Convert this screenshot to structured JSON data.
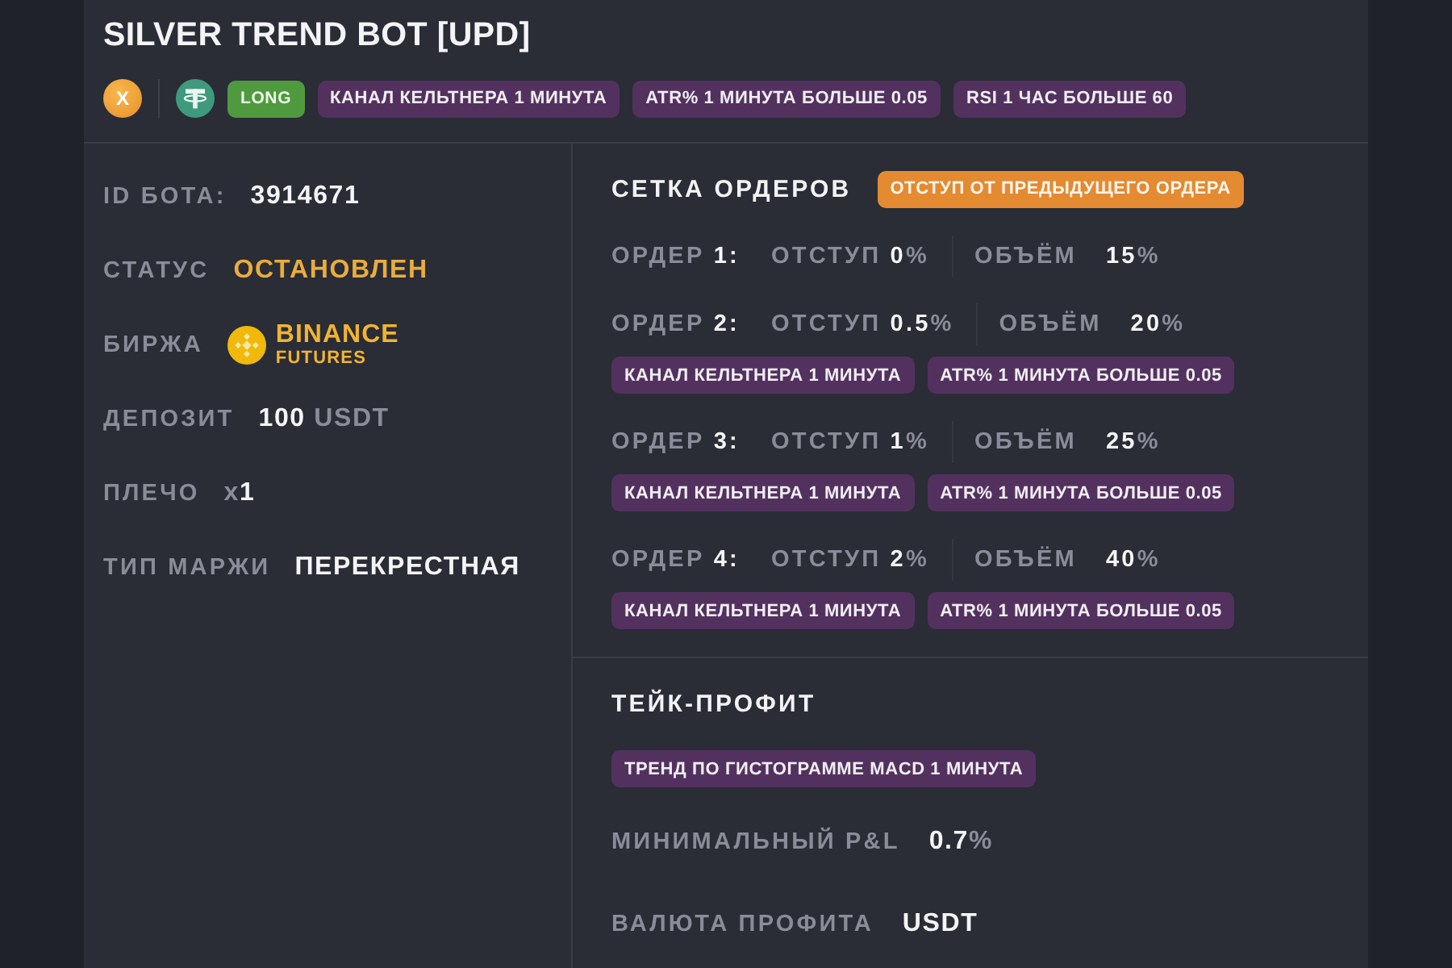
{
  "header": {
    "title": "SILVER TREND BOT [UPD]",
    "coin_symbol": "X",
    "tags": [
      {
        "kind": "side",
        "label": "LONG"
      },
      {
        "kind": "condition",
        "label": "КАНАЛ КЕЛЬТНЕРА 1 МИНУТА"
      },
      {
        "kind": "condition",
        "label": "ATR% 1 МИНУТА БОЛЬШЕ 0.05"
      },
      {
        "kind": "condition",
        "label": "RSI 1 ЧАС БОЛЬШЕ 60"
      }
    ]
  },
  "bot_info": [
    {
      "kind": "plain",
      "label": "ID БОТА:",
      "value": "3914671"
    },
    {
      "kind": "status",
      "label": "СТАТУС",
      "value": "ОСТАНОВЛЕН"
    },
    {
      "kind": "exchange",
      "label": "БИРЖА",
      "name": "BINANCE",
      "subtitle": "FUTURES"
    },
    {
      "kind": "amount",
      "label": "ДЕПОЗИТ",
      "value": "**100** USDT"
    },
    {
      "kind": "amount",
      "label": "ПЛЕЧО",
      "value": "x**1**"
    },
    {
      "kind": "plain",
      "label": "ТИП МАРЖИ",
      "value": "ПЕРЕКРЕСТНАЯ"
    }
  ],
  "order_grid": {
    "title": "СЕТКА ОРДЕРОВ",
    "mode_tag": {
      "kind": "mode",
      "label": "ОТСТУП ОТ ПРЕДЫДУЩЕГО ОРДЕРА"
    },
    "orders": [
      {
        "label": "ОРДЕР **1:**",
        "offset": "ОТСТУП **0**%",
        "volume_label": "ОБЪЁМ",
        "volume": "**15**%"
      },
      {
        "label": "ОРДЕР **2:**",
        "offset": "ОТСТУП **0.5**%",
        "volume_label": "ОБЪЁМ",
        "volume": "**20**%",
        "tags": [
          {
            "kind": "condition",
            "label": "КАНАЛ КЕЛЬТНЕРА 1 МИНУТА"
          },
          {
            "kind": "condition",
            "label": "ATR% 1 МИНУТА БОЛЬШЕ 0.05"
          }
        ]
      },
      {
        "label": "ОРДЕР **3:**",
        "offset": "ОТСТУП **1**%",
        "volume_label": "ОБЪЁМ",
        "volume": "**25**%",
        "tags": [
          {
            "kind": "condition",
            "label": "КАНАЛ КЕЛЬТНЕРА 1 МИНУТА"
          },
          {
            "kind": "condition",
            "label": "ATR% 1 МИНУТА БОЛЬШЕ 0.05"
          }
        ]
      },
      {
        "label": "ОРДЕР **4:**",
        "offset": "ОТСТУП **2**%",
        "volume_label": "ОБЪЁМ",
        "volume": "**40**%",
        "tags": [
          {
            "kind": "condition",
            "label": "КАНАЛ КЕЛЬТНЕРА 1 МИНУТА"
          },
          {
            "kind": "condition",
            "label": "ATR% 1 МИНУТА БОЛЬШЕ 0.05"
          }
        ]
      }
    ]
  },
  "take_profit": {
    "title": "ТЕЙК-ПРОФИТ",
    "tags": [
      {
        "kind": "condition",
        "label": "ТРЕНД ПО ГИСТОГРАММЕ MACD 1 МИНУТА"
      }
    ],
    "rows": [
      {
        "kind": "amount",
        "label": "МИНИМАЛЬНЫЙ P&L",
        "value": "**0.7**%"
      },
      {
        "kind": "plain",
        "label": "ВАЛЮТА ПРОФИТА",
        "value": "USDT"
      }
    ]
  }
}
